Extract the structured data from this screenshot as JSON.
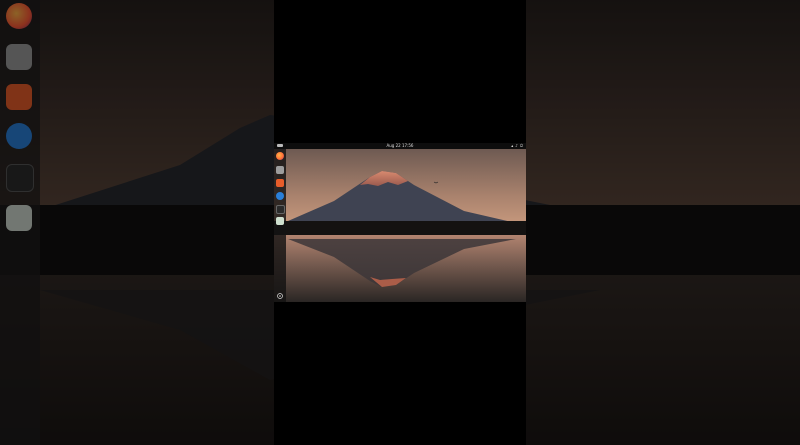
{
  "desktop": {
    "topbar": {
      "clock": "Aug 22 17:56",
      "tray_icons": [
        "network-icon",
        "volume-icon",
        "power-icon"
      ]
    },
    "dock": {
      "apps": [
        {
          "name": "firefox",
          "icon": "firefox-icon"
        },
        {
          "name": "files",
          "icon": "files-icon"
        },
        {
          "name": "software",
          "icon": "software-icon"
        },
        {
          "name": "help",
          "icon": "help-icon"
        },
        {
          "name": "terminal",
          "icon": "terminal-icon"
        },
        {
          "name": "trash",
          "icon": "trash-icon"
        }
      ],
      "show_apps_icon": "app-grid-icon"
    },
    "wallpaper": "mountain-reflection-lake-sunset"
  },
  "colors": {
    "sky_top": "#6e5a52",
    "sky_bottom": "#c99a7e",
    "mountain": "#3f4352",
    "snow": "#b96d5a",
    "water": "#2a2624",
    "accent_firefox": "#ff7139",
    "accent_help": "#2a7fd8",
    "accent_software": "#e85d2a"
  }
}
